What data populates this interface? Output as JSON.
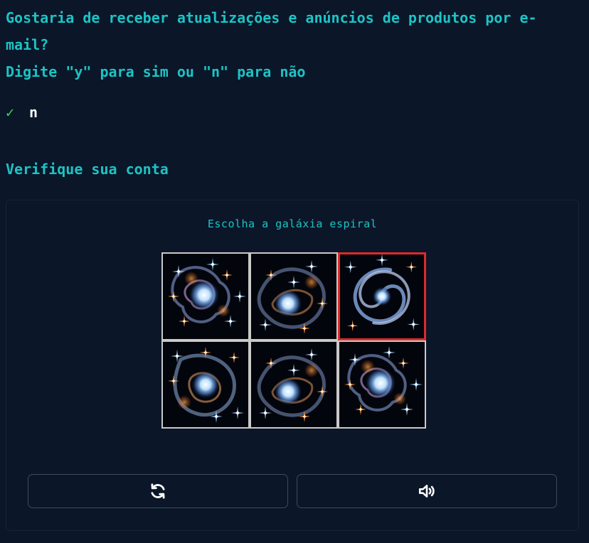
{
  "prompt": {
    "line1": "Gostaria de receber atualizações e anúncios de produtos por e-",
    "line2": "mail?",
    "line3": "Digite \"y\" para sim ou \"n\" para não"
  },
  "answer": {
    "check": "✓",
    "value": "n"
  },
  "section_title": "Verifique sua conta",
  "captcha": {
    "instruction": "Escolha a galáxia espiral",
    "tiles": [
      {
        "icon": "irregular-galaxy-image",
        "selected": false
      },
      {
        "icon": "irregular-galaxy-image",
        "selected": false
      },
      {
        "icon": "spiral-galaxy-image",
        "selected": true
      },
      {
        "icon": "irregular-galaxy-image",
        "selected": false
      },
      {
        "icon": "irregular-galaxy-image",
        "selected": false
      },
      {
        "icon": "irregular-galaxy-image",
        "selected": false
      }
    ],
    "buttons": {
      "refresh_icon": "refresh-icon",
      "audio_icon": "speaker-icon"
    }
  },
  "colors": {
    "background": "#0b1629",
    "accent": "#1cc4c4",
    "check": "#3fd65a",
    "selected_border": "#e02a2a"
  }
}
